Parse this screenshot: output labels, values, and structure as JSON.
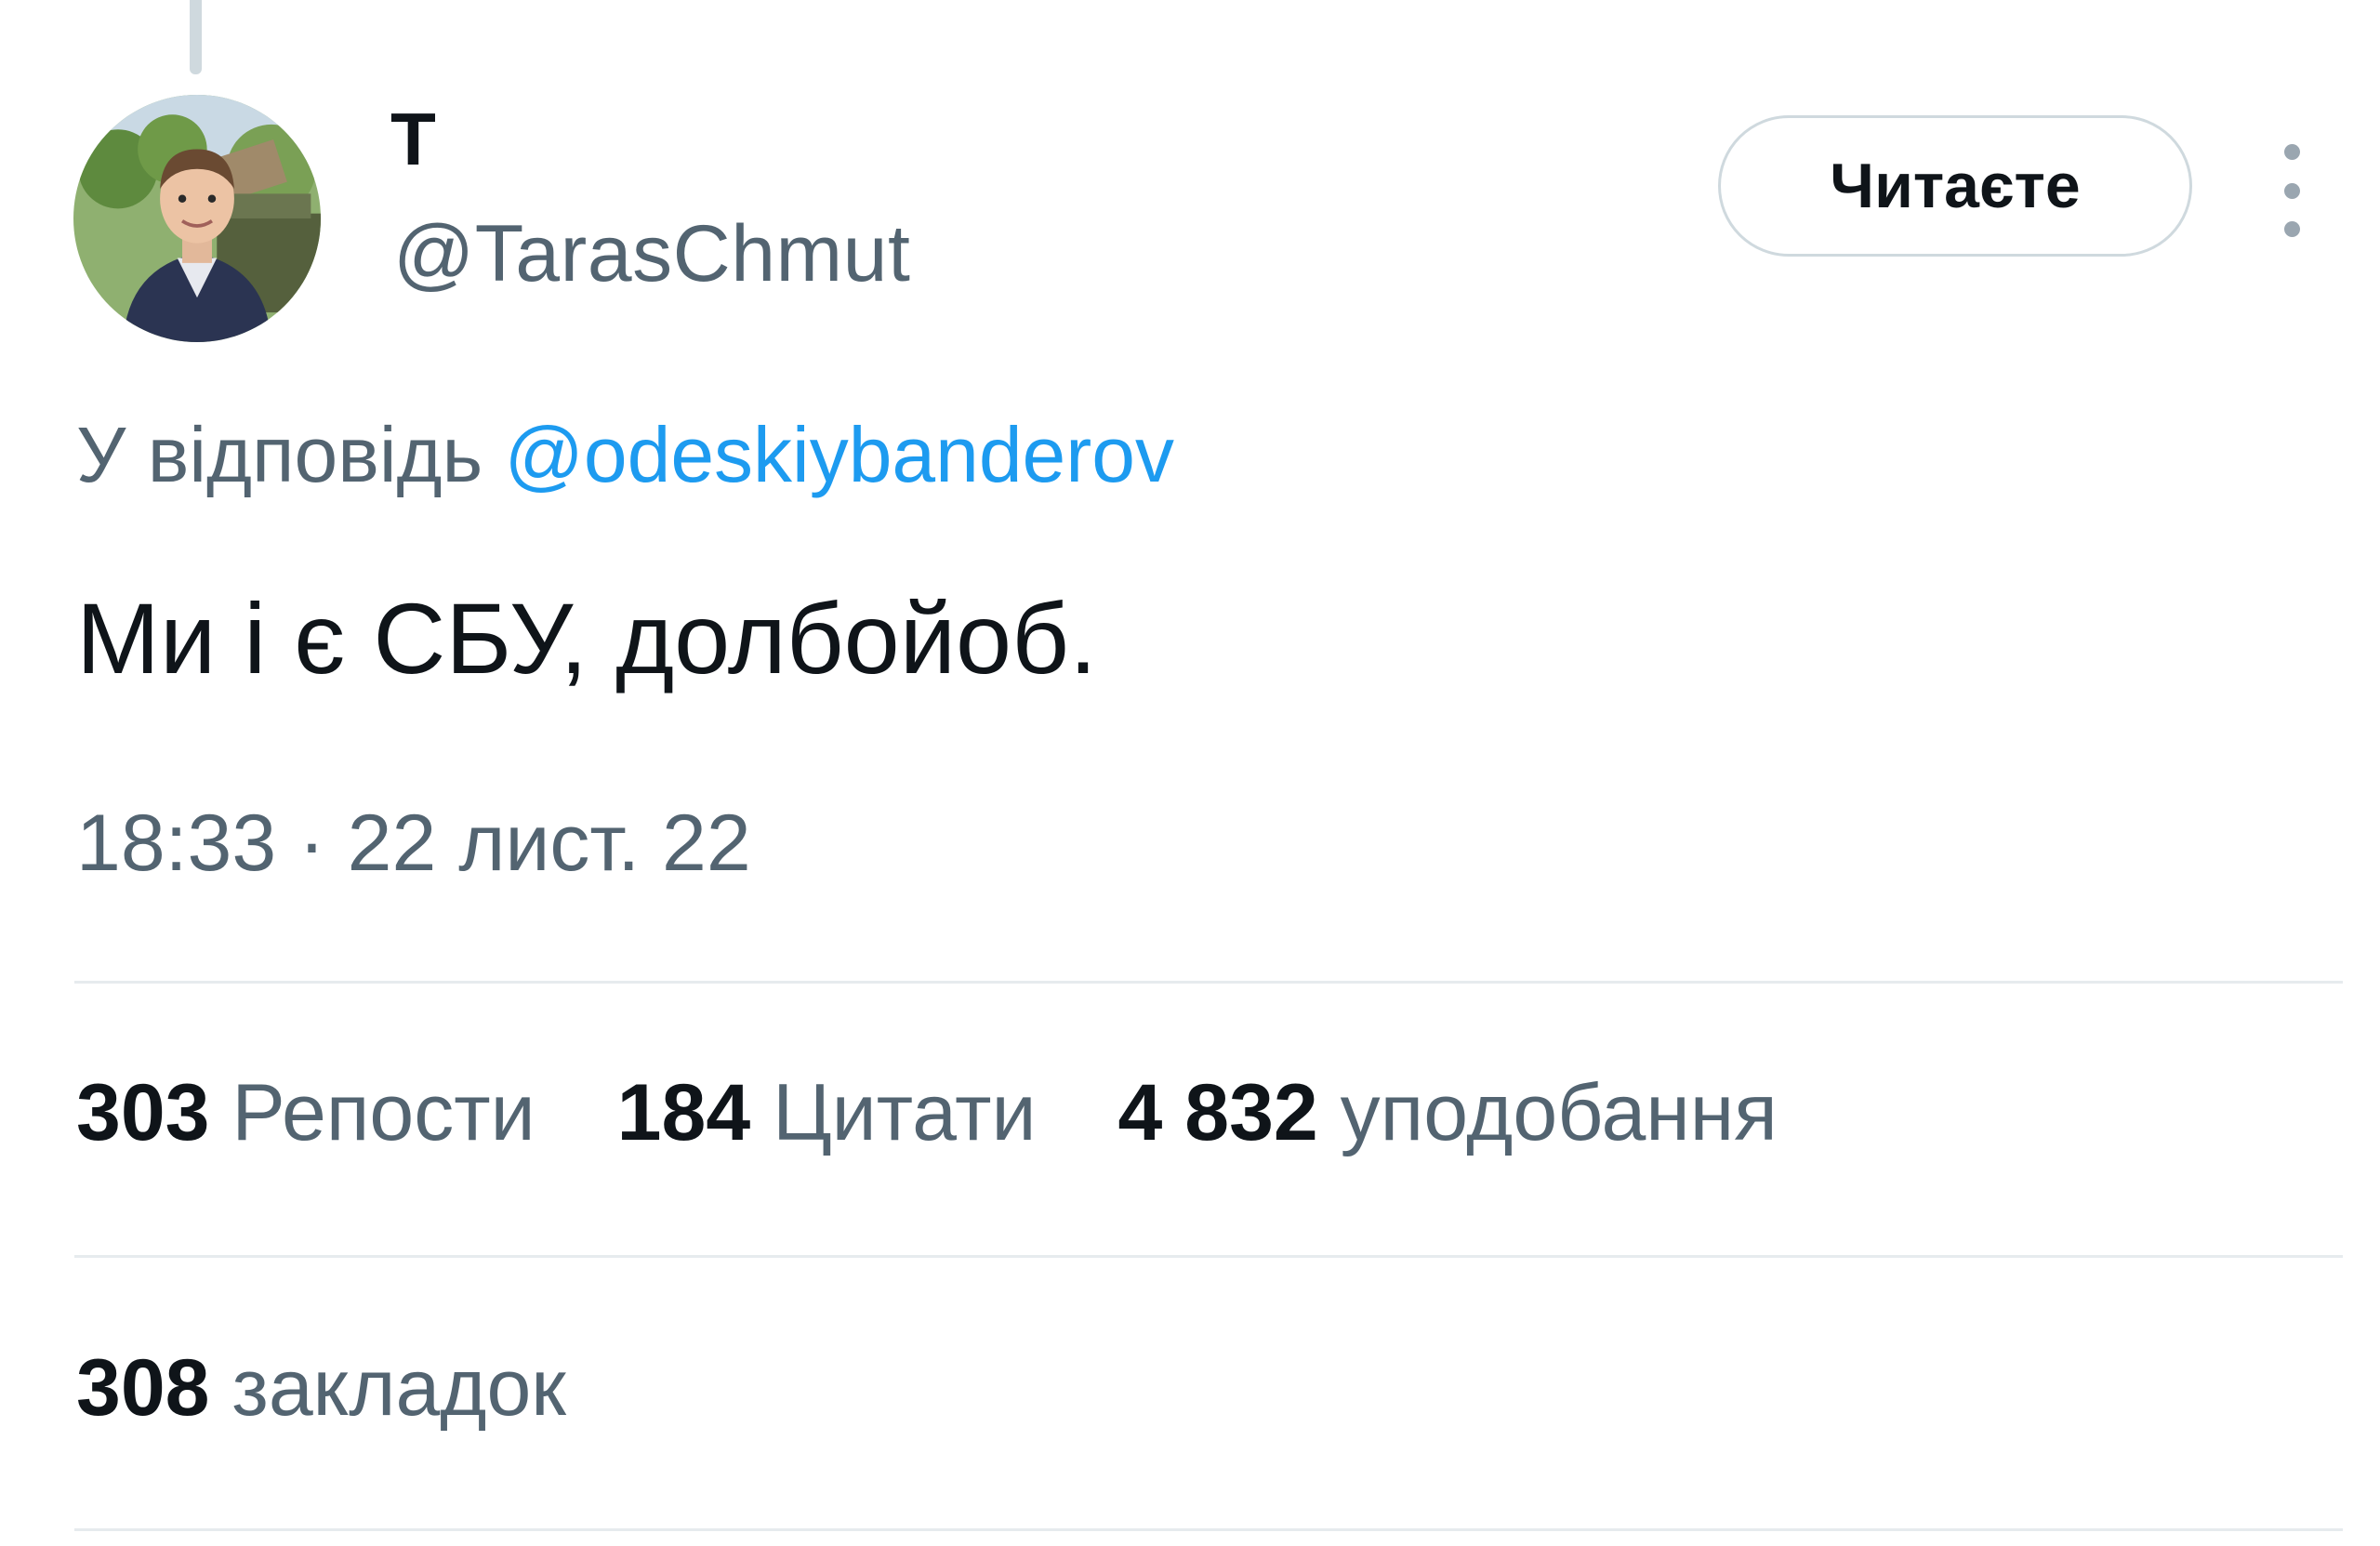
{
  "author": {
    "display_name": "Т",
    "handle": "@TarasChmut"
  },
  "follow_button": {
    "label": "Читаєте"
  },
  "reply": {
    "prefix": "У відповідь ",
    "mention": "@odeskiybanderov"
  },
  "tweet": {
    "text": "Ми і є СБУ, долбойоб."
  },
  "timestamp": "18:33 · 22 лист. 22",
  "stats": {
    "reposts": {
      "count": "303",
      "label": "Репости"
    },
    "quotes": {
      "count": "184",
      "label": "Цитати"
    },
    "likes": {
      "count": "4 832",
      "label": "уподобання"
    },
    "bookmarks": {
      "count": "308",
      "label": "закладок"
    }
  },
  "icons": {
    "more": "vertical-ellipsis-icon"
  },
  "colors": {
    "text": "#0f1419",
    "secondary_text": "#536471",
    "link": "#1d9bf0",
    "divider": "#e6ebee",
    "button_border": "#cfd9de"
  }
}
